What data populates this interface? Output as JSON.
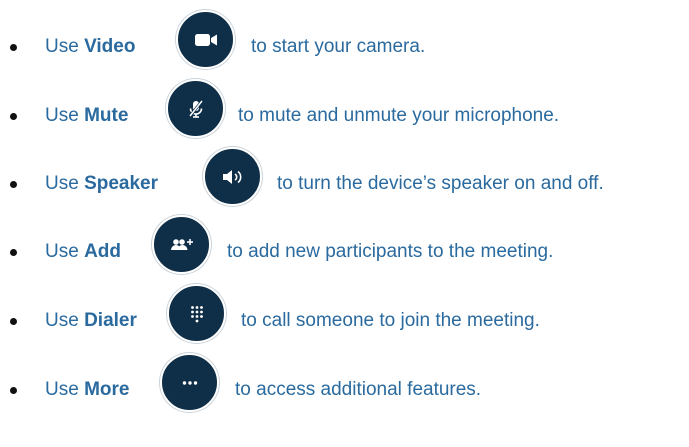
{
  "items": [
    {
      "prefix": "Use",
      "label": "Video",
      "suffix": "to start your camera.",
      "icon": "video-camera-icon"
    },
    {
      "prefix": "Use",
      "label": "Mute",
      "suffix": "to mute and unmute your microphone.",
      "icon": "microphone-muted-icon"
    },
    {
      "prefix": "Use",
      "label": "Speaker",
      "suffix": "to turn the device’s speaker on and off.",
      "icon": "speaker-icon"
    },
    {
      "prefix": "Use",
      "label": "Add",
      "suffix": "to add new participants to the meeting.",
      "icon": "add-participant-icon"
    },
    {
      "prefix": "Use",
      "label": "Dialer",
      "suffix": "to call someone to join the meeting.",
      "icon": "dialpad-icon"
    },
    {
      "prefix": "Use",
      "label": "More",
      "suffix": "to access additional features.",
      "icon": "more-options-icon"
    }
  ],
  "colors": {
    "text": "#2a6a9e",
    "icon_background": "#0f2e47",
    "icon_glyph": "#ffffff",
    "bullet": "#111111"
  }
}
